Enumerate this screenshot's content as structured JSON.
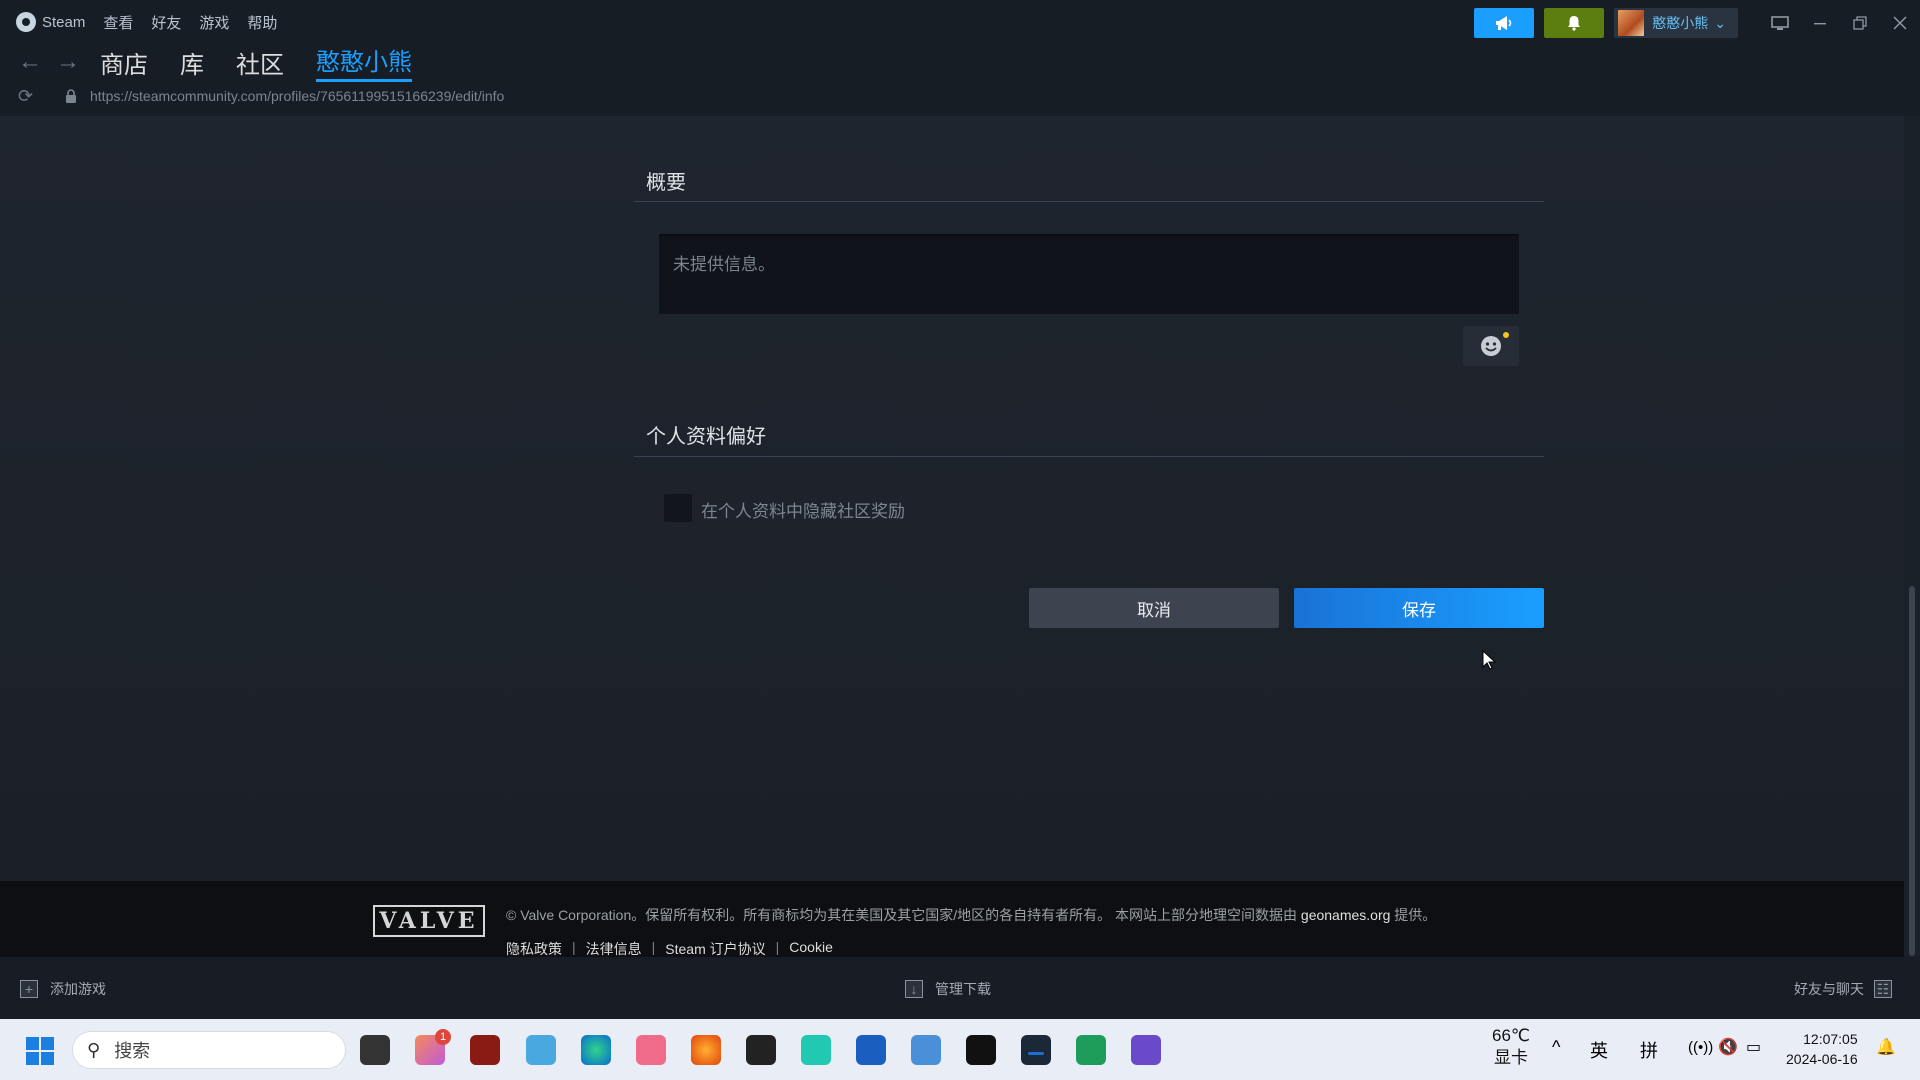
{
  "menu": {
    "app_name": "Steam",
    "items": [
      "查看",
      "好友",
      "游戏",
      "帮助"
    ]
  },
  "header": {
    "username": "憨憨小熊",
    "username_chevron": "⌄"
  },
  "nav": {
    "back": "←",
    "forward": "→",
    "tabs": [
      "商店",
      "库",
      "社区",
      "憨憨小熊"
    ],
    "active_tab_index": 3
  },
  "urlbar": {
    "url": "https://steamcommunity.com/profiles/76561199515166239/edit/info"
  },
  "summary": {
    "title": "概要",
    "placeholder_text": "未提供信息。"
  },
  "preferences": {
    "title": "个人资料偏好",
    "hide_awards_label": "在个人资料中隐藏社区奖励",
    "hide_awards_checked": false
  },
  "actions": {
    "cancel_label": "取消",
    "save_label": "保存"
  },
  "footer": {
    "valve_logo_text": "VALVE",
    "copyright_prefix": "© Valve Corporation。保留所有权利。所有商标均为其在美国及其它国家/地区的各自持有者所有。 本网站上部分地理空间数据由 ",
    "geonames": "geonames.org",
    "copyright_suffix": " 提供。",
    "links": [
      "隐私政策",
      "法律信息",
      "Steam 订户协议",
      "Cookie"
    ],
    "separator": "|"
  },
  "bottombar": {
    "add_game": "添加游戏",
    "manage_downloads": "管理下载",
    "friends_chat": "好友与聊天"
  },
  "taskbar": {
    "search_placeholder": "搜索",
    "weather_temp": "66℃",
    "weather_label": "显卡",
    "ime_lang": "英",
    "ime_mode": "拼",
    "time": "12:07:05",
    "date": "2024-06-16",
    "badge_count": "1"
  },
  "colors": {
    "accent": "#1a9fff",
    "notify": "#5c7e10",
    "background": "#1b2129"
  }
}
